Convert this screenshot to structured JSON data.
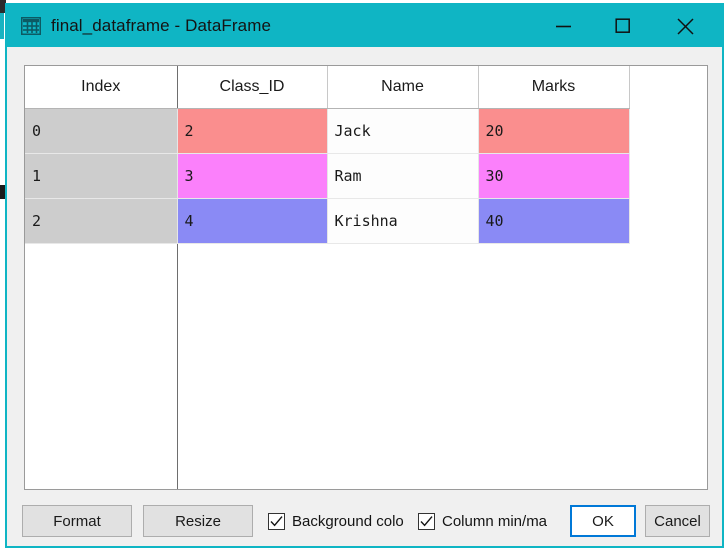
{
  "window": {
    "title": "final_dataframe - DataFrame",
    "icon": "grid-table-icon",
    "titlebar_color": "#0fb5c4",
    "controls": {
      "minimize": "minimize-icon",
      "maximize": "maximize-icon",
      "close": "close-icon"
    }
  },
  "table": {
    "headers": [
      "Index",
      "Class_ID",
      "Name",
      "Marks"
    ],
    "rows": [
      {
        "index": "0",
        "class_id": "2",
        "name": "Jack",
        "marks": "20",
        "row_color": "#fa8e8e"
      },
      {
        "index": "1",
        "class_id": "3",
        "name": "Ram",
        "marks": "30",
        "row_color": "#fb80fb"
      },
      {
        "index": "2",
        "class_id": "4",
        "name": "Krishna",
        "marks": "40",
        "row_color": "#8a8af5"
      }
    ],
    "index_column_color": "#cdcdcd"
  },
  "bottom_bar": {
    "format_label": "Format",
    "resize_label": "Resize",
    "background_color_label": "Background colo",
    "column_minmax_label": "Column min/ma",
    "background_color_checked": true,
    "column_minmax_checked": true,
    "ok_label": "OK",
    "cancel_label": "Cancel",
    "focus_color": "#0078d7"
  }
}
